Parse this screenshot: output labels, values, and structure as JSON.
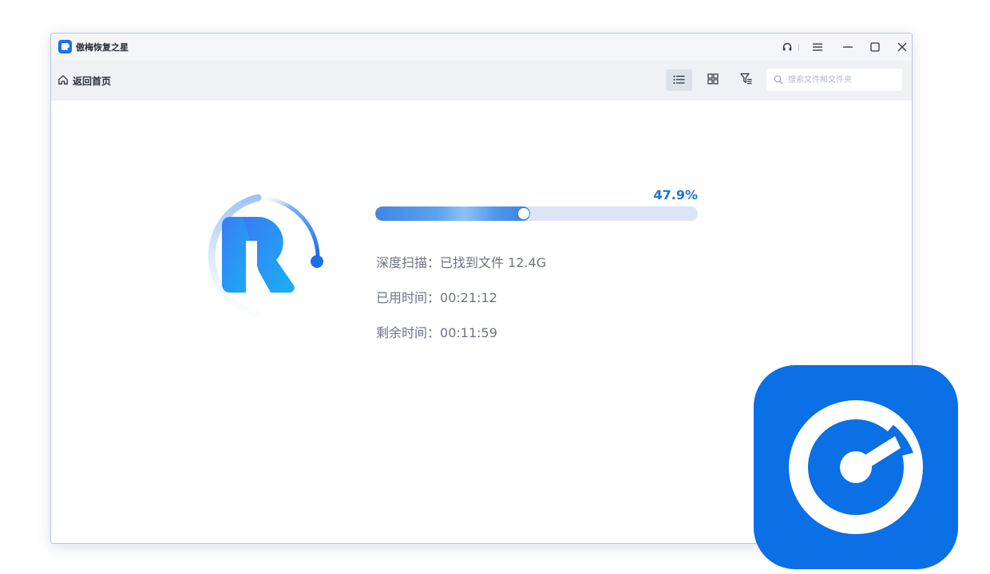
{
  "window": {
    "title": "傲梅恢复之星"
  },
  "toolbar": {
    "home_label": "返回首页",
    "search_placeholder": "搜索文件和文件夹"
  },
  "scan": {
    "percent_text": "47.9%",
    "progress_fraction": 0.479,
    "deep_scan_label": "深度扫描：",
    "deep_scan_value": "已找到文件 12.4G",
    "elapsed_label": "已用时间：",
    "elapsed_value": "00:21:12",
    "remaining_label": "剩余时间：",
    "remaining_value": "00:11:59"
  },
  "colors": {
    "accent": "#1b73d8",
    "brand_icon_bg": "#0b6fe5",
    "progress_track": "#dce4f6"
  },
  "icons": {
    "support": "headset-icon",
    "menu": "hamburger-menu-icon",
    "minimize": "minimize-icon",
    "maximize": "maximize-icon",
    "close": "close-icon",
    "home": "home-icon",
    "list_view": "list-view-icon",
    "grid_view": "grid-view-icon",
    "filter": "filter-icon",
    "search": "search-icon"
  }
}
